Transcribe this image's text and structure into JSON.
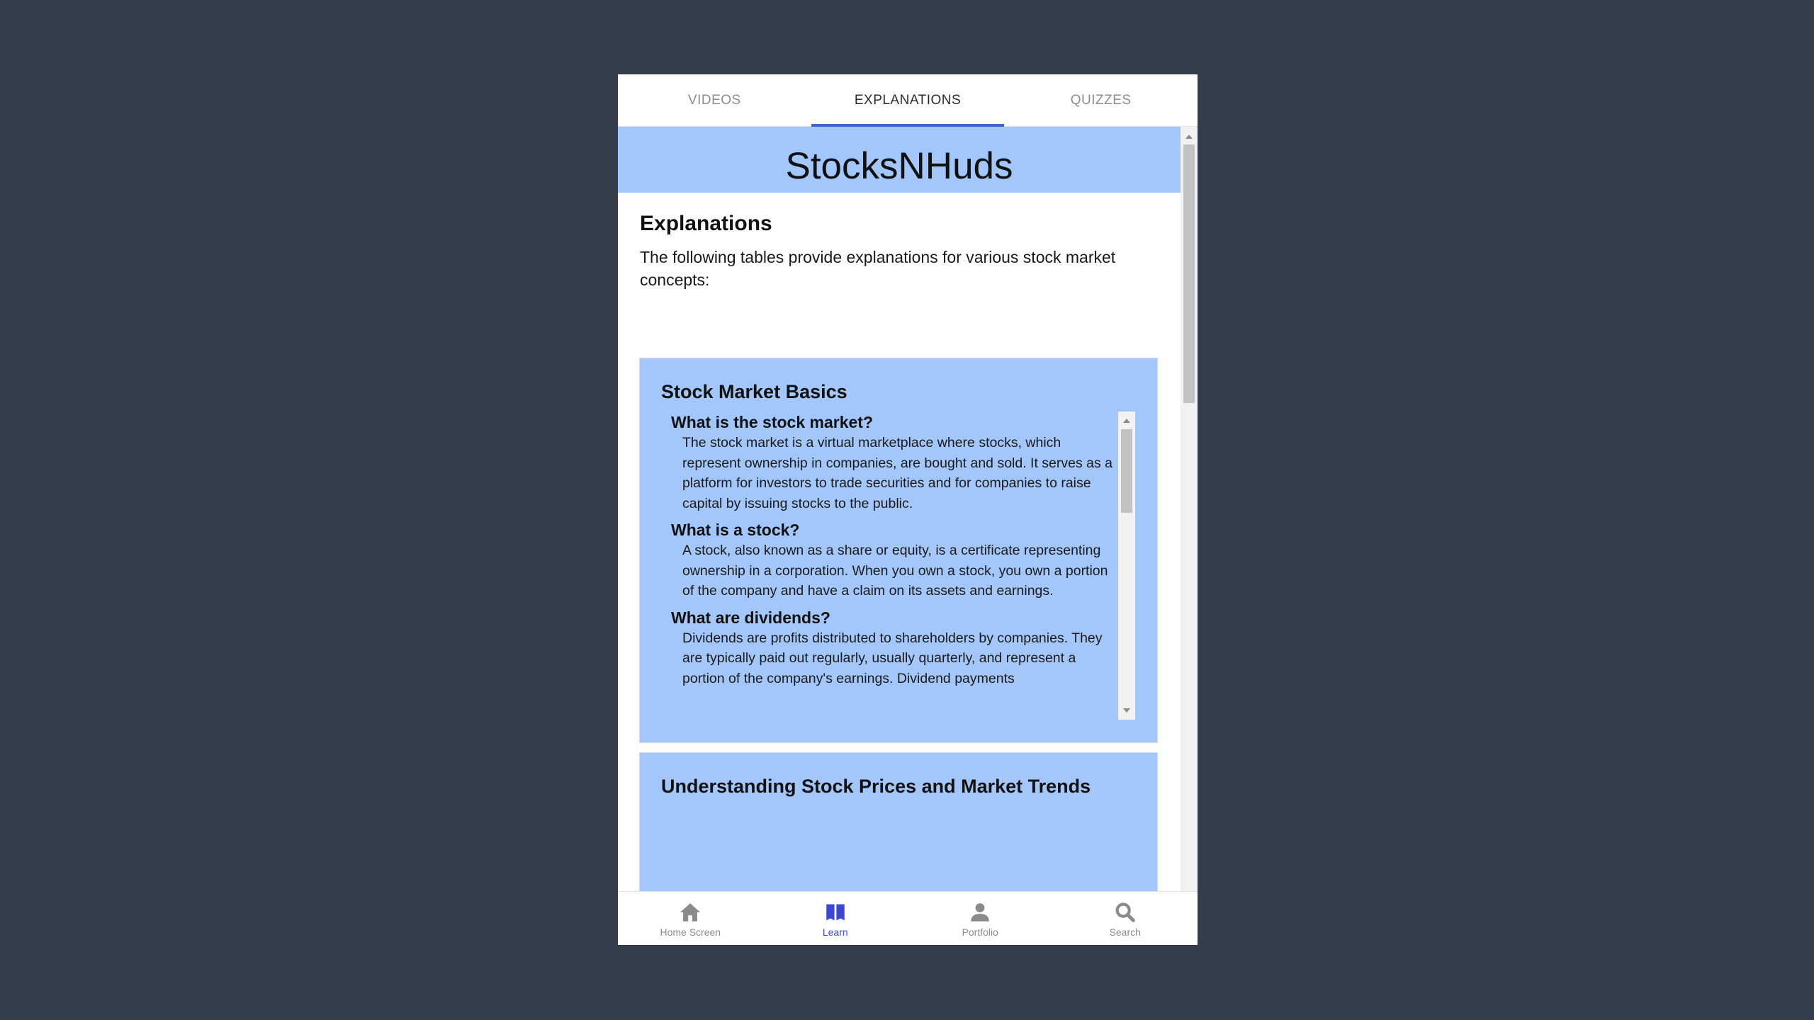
{
  "tabs": [
    {
      "label": "VIDEOS"
    },
    {
      "label": "EXPLANATIONS"
    },
    {
      "label": "QUIZZES"
    }
  ],
  "brand": "StocksNHuds",
  "page": {
    "title": "Explanations",
    "intro": "The following tables provide explanations for various stock market concepts:"
  },
  "cards": [
    {
      "title": "Stock Market Basics",
      "items": [
        {
          "question": "What is the stock market?",
          "answer": "The stock market is a virtual marketplace where stocks, which represent ownership in companies, are bought and sold. It serves as a platform for investors to trade securities and for companies to raise capital by issuing stocks to the public."
        },
        {
          "question": "What is a stock?",
          "answer": "A stock, also known as a share or equity, is a certificate representing ownership in a corporation. When you own a stock, you own a portion of the company and have a claim on its assets and earnings."
        },
        {
          "question": "What are dividends?",
          "answer": "Dividends are profits distributed to shareholders by companies. They are typically paid out regularly, usually quarterly, and represent a portion of the company's earnings. Dividend payments"
        }
      ]
    },
    {
      "title": "Understanding Stock Prices and Market Trends"
    }
  ],
  "bottom_nav": [
    {
      "label": "Home Screen",
      "icon": "home-icon"
    },
    {
      "label": "Learn",
      "icon": "book-icon"
    },
    {
      "label": "Portfolio",
      "icon": "user-icon"
    },
    {
      "label": "Search",
      "icon": "search-icon"
    }
  ],
  "colors": {
    "background": "#343c4d",
    "card": "#a3c7fb",
    "accent": "#3d67d8",
    "nav_active": "#3a46d6",
    "nav_inactive": "#8a8a8a"
  }
}
